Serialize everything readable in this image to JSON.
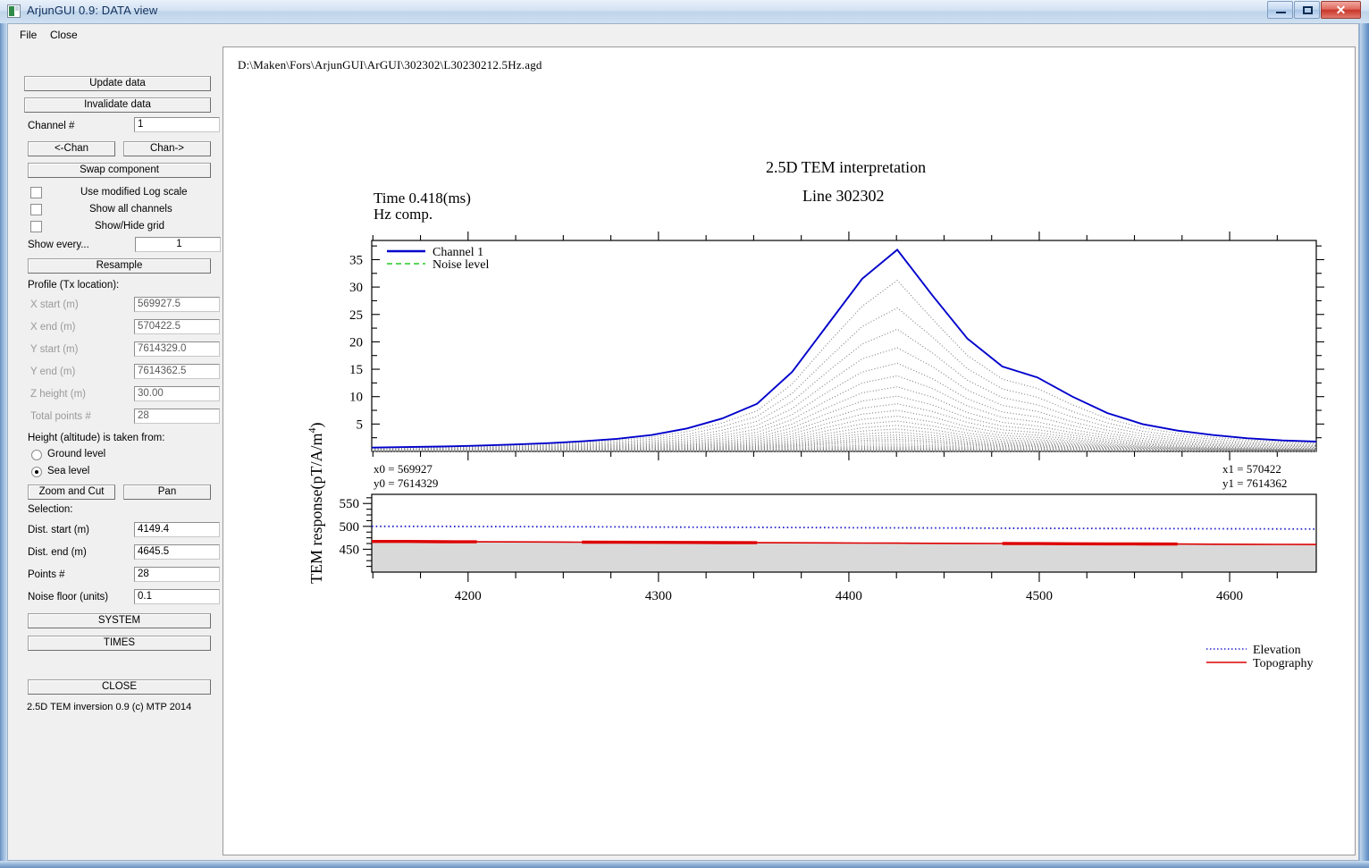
{
  "window": {
    "title": "ArjunGUI 0.9: DATA view",
    "icon": "app-icon",
    "minimize": "minimize-icon",
    "maximize": "maximize-icon",
    "close": "✕"
  },
  "menu": {
    "items": [
      "File",
      "Close"
    ]
  },
  "sidebar": {
    "update_data": "Update data",
    "invalidate_data": "Invalidate data",
    "channel_label": "Channel #",
    "channel_value": "1",
    "chan_prev": "<-Chan",
    "chan_next": "Chan->",
    "swap_component": "Swap component",
    "checkboxes": [
      {
        "label": "Use modified Log scale",
        "checked": false
      },
      {
        "label": "Show all channels",
        "checked": false
      },
      {
        "label": "Show/Hide grid",
        "checked": false
      }
    ],
    "show_every_label": "Show every...",
    "show_every_value": "1",
    "resample": "Resample",
    "profile_header": "Profile (Tx location):",
    "profile_fields": [
      {
        "label": "X start (m)",
        "value": "569927.5"
      },
      {
        "label": "X end (m)",
        "value": "570422.5"
      },
      {
        "label": "Y start (m)",
        "value": "7614329.0"
      },
      {
        "label": "Y end (m)",
        "value": "7614362.5"
      },
      {
        "label": "Z height (m)",
        "value": "30.00"
      },
      {
        "label": "Total points #",
        "value": "28"
      }
    ],
    "height_header": "Height (altitude) is taken from:",
    "height_options": [
      {
        "label": "Ground level",
        "selected": false
      },
      {
        "label": "Sea level",
        "selected": true
      }
    ],
    "zoom_and_cut": "Zoom and Cut",
    "pan": "Pan",
    "selection_header": "Selection:",
    "selection_fields": [
      {
        "label": "Dist. start (m)",
        "value": "4149.4"
      },
      {
        "label": "Dist. end (m)",
        "value": "4645.5"
      },
      {
        "label": "Points #",
        "value": "28"
      },
      {
        "label": "Noise floor (units)",
        "value": "0.1"
      }
    ],
    "system": "SYSTEM",
    "times": "TIMES",
    "close": "CLOSE",
    "copyright": "2.5D TEM inversion 0.9 (c) MTP 2014"
  },
  "plot": {
    "file_path": "D:\\Maken\\Fors\\ArjunGUI\\ArGUI\\302302\\L30230212.5Hz.agd",
    "title": "2.5D TEM interpretation",
    "subtitle": "Line   302302",
    "time_label": "Time   0.418(ms)",
    "component_label": "Hz comp.",
    "coords": {
      "x0_label": "x0 =",
      "x0_value": "569927",
      "y0_label": "y0 =",
      "y0_value": "7614329",
      "x1_label": "x1 =",
      "x1_value": "570422",
      "y1_label": "y1 =",
      "y1_value": "7614362"
    }
  },
  "chart_data": [
    {
      "type": "line",
      "name": "tem-response-plot",
      "title": "2.5D TEM interpretation",
      "subtitle": "Line   302302",
      "xlabel": "",
      "ylabel": "TEM response(pT/A/m",
      "ylabel_sup": "4",
      "ylabel_suffix": ")",
      "xlim": [
        4149.4,
        4645.5
      ],
      "ylim": [
        0,
        38.5
      ],
      "yticks": [
        5,
        10,
        15,
        20,
        25,
        30,
        35
      ],
      "ytick_labels": [
        "5",
        "10",
        "15",
        "20",
        "25",
        "30",
        "35"
      ],
      "xticks": [
        4200,
        4300,
        4400,
        4500,
        4600
      ],
      "grid": false,
      "legend": [
        {
          "label": "Channel 1",
          "color": "#0000cc",
          "style": "solid"
        },
        {
          "label": "Noise level",
          "color": "#22cc22",
          "style": "dashed"
        }
      ],
      "legend_position": "top-left",
      "x": [
        4149.4,
        4167.8,
        4186.2,
        4204.6,
        4223.0,
        4241.4,
        4259.8,
        4278.2,
        4296.6,
        4315.0,
        4333.4,
        4351.8,
        4370.2,
        4388.6,
        4407.0,
        4425.4,
        4443.8,
        4462.2,
        4480.6,
        4499.0,
        4517.4,
        4535.8,
        4554.2,
        4572.6,
        4591.0,
        4609.4,
        4627.8,
        4645.5
      ],
      "series": [
        {
          "name": "Channel 1",
          "color": "#0000cc",
          "style": "solid",
          "values": [
            0.7,
            0.8,
            0.9,
            1.05,
            1.25,
            1.5,
            1.85,
            2.3,
            3.0,
            4.2,
            6.0,
            8.7,
            14.5,
            23.0,
            31.5,
            36.8,
            28.5,
            20.6,
            15.5,
            13.5,
            10.0,
            7.0,
            5.0,
            3.8,
            3.0,
            2.4,
            2.0,
            1.8
          ]
        },
        {
          "name": "Channel 2",
          "color": "#808080",
          "style": "dotted",
          "values": [
            0.6,
            0.68,
            0.78,
            0.9,
            1.05,
            1.3,
            1.6,
            2.0,
            2.6,
            3.6,
            5.2,
            7.4,
            12.3,
            19.6,
            26.5,
            31.2,
            24.2,
            17.5,
            13.2,
            11.5,
            8.5,
            6.0,
            4.3,
            3.3,
            2.6,
            2.1,
            1.75,
            1.55
          ]
        },
        {
          "name": "Channel 3",
          "color": "#808080",
          "style": "dotted",
          "values": [
            0.52,
            0.59,
            0.67,
            0.78,
            0.92,
            1.12,
            1.38,
            1.72,
            2.25,
            3.1,
            4.5,
            6.4,
            10.6,
            16.8,
            22.8,
            26.2,
            20.9,
            15.1,
            11.4,
            9.9,
            7.3,
            5.2,
            3.7,
            2.85,
            2.25,
            1.82,
            1.5,
            1.34
          ]
        },
        {
          "name": "Channel 4",
          "color": "#808080",
          "style": "dotted",
          "values": [
            0.45,
            0.51,
            0.58,
            0.67,
            0.79,
            0.96,
            1.19,
            1.48,
            1.94,
            2.67,
            3.87,
            5.5,
            9.1,
            14.5,
            19.6,
            22.3,
            18.0,
            13.0,
            9.8,
            8.5,
            6.3,
            4.5,
            3.2,
            2.45,
            1.94,
            1.57,
            1.29,
            1.15
          ]
        },
        {
          "name": "Channel 5",
          "color": "#808080",
          "style": "dotted",
          "values": [
            0.39,
            0.44,
            0.5,
            0.58,
            0.68,
            0.83,
            1.02,
            1.28,
            1.67,
            2.3,
            3.33,
            4.74,
            7.8,
            12.5,
            16.9,
            18.9,
            15.5,
            11.2,
            8.4,
            7.3,
            5.4,
            3.87,
            2.75,
            2.11,
            1.67,
            1.35,
            1.11,
            0.99
          ]
        },
        {
          "name": "Channel 6",
          "color": "#808080",
          "style": "dotted",
          "values": [
            0.33,
            0.38,
            0.43,
            0.5,
            0.59,
            0.71,
            0.88,
            1.1,
            1.44,
            1.98,
            2.87,
            4.08,
            6.7,
            10.8,
            14.5,
            16.1,
            13.3,
            9.6,
            7.2,
            6.3,
            4.7,
            3.33,
            2.37,
            1.82,
            1.44,
            1.16,
            0.96,
            0.85
          ]
        },
        {
          "name": "Channel 7",
          "color": "#808080",
          "style": "dotted",
          "values": [
            0.29,
            0.33,
            0.37,
            0.43,
            0.51,
            0.61,
            0.76,
            0.95,
            1.24,
            1.71,
            2.47,
            3.51,
            5.8,
            9.3,
            12.5,
            13.8,
            11.5,
            8.3,
            6.2,
            5.4,
            4.0,
            2.87,
            2.04,
            1.57,
            1.24,
            1.0,
            0.82,
            0.73
          ]
        },
        {
          "name": "Channel 8",
          "color": "#808080",
          "style": "dotted",
          "values": [
            0.25,
            0.28,
            0.32,
            0.37,
            0.44,
            0.53,
            0.65,
            0.82,
            1.07,
            1.47,
            2.13,
            3.02,
            5.0,
            8.0,
            10.7,
            11.8,
            9.9,
            7.1,
            5.3,
            4.65,
            3.45,
            2.47,
            1.76,
            1.35,
            1.07,
            0.86,
            0.71,
            0.63
          ]
        },
        {
          "name": "Channel 9",
          "color": "#808080",
          "style": "dotted",
          "values": [
            0.215,
            0.24,
            0.28,
            0.32,
            0.38,
            0.46,
            0.56,
            0.7,
            0.92,
            1.26,
            1.83,
            2.6,
            4.3,
            6.9,
            9.2,
            10.1,
            8.5,
            6.1,
            4.6,
            4.0,
            2.97,
            2.13,
            1.51,
            1.16,
            0.92,
            0.74,
            0.61,
            0.54
          ]
        },
        {
          "name": "Channel 10",
          "color": "#808080",
          "style": "dotted",
          "values": [
            0.185,
            0.21,
            0.24,
            0.275,
            0.33,
            0.39,
            0.49,
            0.61,
            0.79,
            1.09,
            1.58,
            2.24,
            3.7,
            5.9,
            7.9,
            8.7,
            7.3,
            5.3,
            3.95,
            3.45,
            2.56,
            1.83,
            1.3,
            1.0,
            0.79,
            0.64,
            0.52,
            0.47
          ]
        },
        {
          "name": "Channel 11",
          "color": "#808080",
          "style": "dotted",
          "values": [
            0.16,
            0.18,
            0.205,
            0.24,
            0.28,
            0.34,
            0.42,
            0.52,
            0.68,
            0.94,
            1.36,
            1.93,
            3.19,
            5.1,
            6.8,
            7.5,
            6.3,
            4.5,
            3.4,
            2.97,
            2.2,
            1.58,
            1.12,
            0.86,
            0.68,
            0.55,
            0.45,
            0.4
          ]
        },
        {
          "name": "Channel 12",
          "color": "#808080",
          "style": "dotted",
          "values": [
            0.137,
            0.155,
            0.176,
            0.205,
            0.24,
            0.29,
            0.36,
            0.45,
            0.59,
            0.81,
            1.17,
            1.66,
            2.74,
            4.4,
            5.85,
            6.45,
            5.4,
            3.9,
            2.92,
            2.55,
            1.89,
            1.36,
            0.96,
            0.74,
            0.59,
            0.47,
            0.39,
            0.345
          ]
        },
        {
          "name": "Channel 13",
          "color": "#808080",
          "style": "dotted",
          "values": [
            0.118,
            0.133,
            0.152,
            0.176,
            0.21,
            0.25,
            0.31,
            0.385,
            0.5,
            0.69,
            1.0,
            1.43,
            2.36,
            3.78,
            5.03,
            5.55,
            4.65,
            3.35,
            2.51,
            2.19,
            1.62,
            1.16,
            0.83,
            0.635,
            0.5,
            0.41,
            0.335,
            0.3
          ]
        },
        {
          "name": "Channel 14",
          "color": "#808080",
          "style": "dotted",
          "values": [
            0.1,
            0.114,
            0.13,
            0.151,
            0.178,
            0.215,
            0.265,
            0.33,
            0.43,
            0.595,
            0.86,
            1.22,
            2.02,
            3.25,
            4.32,
            4.77,
            4.0,
            2.88,
            2.16,
            1.88,
            1.39,
            1.0,
            0.71,
            0.545,
            0.43,
            0.35,
            0.29,
            0.255
          ]
        },
        {
          "name": "Channel 15",
          "color": "#808080",
          "style": "dotted",
          "values": [
            0.087,
            0.098,
            0.112,
            0.13,
            0.153,
            0.185,
            0.228,
            0.285,
            0.37,
            0.51,
            0.74,
            1.05,
            1.74,
            2.79,
            3.72,
            4.1,
            3.44,
            2.48,
            1.86,
            1.62,
            1.2,
            0.86,
            0.61,
            0.47,
            0.37,
            0.3,
            0.245,
            0.22
          ]
        },
        {
          "name": "Channel 16",
          "color": "#808080",
          "style": "dotted",
          "values": [
            0.074,
            0.084,
            0.096,
            0.112,
            0.132,
            0.159,
            0.196,
            0.245,
            0.32,
            0.44,
            0.635,
            0.9,
            1.49,
            2.4,
            3.19,
            3.52,
            2.95,
            2.13,
            1.6,
            1.39,
            1.03,
            0.74,
            0.525,
            0.4,
            0.32,
            0.26,
            0.21,
            0.19
          ]
        },
        {
          "name": "Channel 17",
          "color": "#808080",
          "style": "dotted",
          "values": [
            0.064,
            0.072,
            0.083,
            0.096,
            0.113,
            0.137,
            0.169,
            0.21,
            0.275,
            0.38,
            0.545,
            0.775,
            1.28,
            2.06,
            2.74,
            3.02,
            2.54,
            1.83,
            1.37,
            1.2,
            0.885,
            0.635,
            0.45,
            0.345,
            0.275,
            0.22,
            0.18,
            0.16
          ]
        },
        {
          "name": "Channel 18",
          "color": "#808080",
          "style": "dotted",
          "values": [
            0.055,
            0.062,
            0.071,
            0.083,
            0.097,
            0.118,
            0.145,
            0.18,
            0.235,
            0.325,
            0.47,
            0.665,
            1.1,
            1.77,
            2.35,
            2.6,
            2.18,
            1.57,
            1.18,
            1.03,
            0.76,
            0.545,
            0.39,
            0.3,
            0.235,
            0.19,
            0.156,
            0.138
          ]
        },
        {
          "name": "Channel 19",
          "color": "#808080",
          "style": "dotted",
          "values": [
            0.047,
            0.053,
            0.061,
            0.071,
            0.084,
            0.101,
            0.125,
            0.156,
            0.2,
            0.28,
            0.4,
            0.57,
            0.95,
            1.52,
            2.02,
            2.23,
            1.87,
            1.35,
            1.01,
            0.88,
            0.65,
            0.47,
            0.33,
            0.255,
            0.2,
            0.163,
            0.134,
            0.118
          ]
        },
        {
          "name": "Channel 20",
          "color": "#808080",
          "style": "dotted",
          "values": [
            0.041,
            0.046,
            0.052,
            0.061,
            0.072,
            0.087,
            0.107,
            0.134,
            0.175,
            0.24,
            0.35,
            0.49,
            0.81,
            1.31,
            1.74,
            1.92,
            1.61,
            1.16,
            0.87,
            0.76,
            0.56,
            0.4,
            0.285,
            0.22,
            0.175,
            0.14,
            0.115,
            0.102
          ]
        }
      ]
    },
    {
      "type": "line",
      "name": "topography-plot",
      "title": "",
      "ylabel": "",
      "xlabel": "",
      "xlim": [
        4149.4,
        4645.5
      ],
      "ylim": [
        400,
        570
      ],
      "yticks": [
        450,
        500,
        550
      ],
      "ytick_labels": [
        "450",
        "500",
        "550"
      ],
      "xticks": [
        4200,
        4300,
        4400,
        4500,
        4600
      ],
      "xtick_labels": [
        "4200",
        "4300",
        "4400",
        "4500",
        "4600"
      ],
      "grid": false,
      "legend": [
        {
          "label": "Elevation",
          "color": "#2222cc",
          "style": "dotted"
        },
        {
          "label": "Topography",
          "color": "#dd0000",
          "style": "solid"
        }
      ],
      "legend_position": "bottom-right",
      "x": [
        4149.4,
        4167.8,
        4186.2,
        4204.6,
        4223.0,
        4241.4,
        4259.8,
        4278.2,
        4296.6,
        4315.0,
        4333.4,
        4351.8,
        4370.2,
        4388.6,
        4407.0,
        4425.4,
        4443.8,
        4462.2,
        4480.6,
        4499.0,
        4517.4,
        4535.8,
        4554.2,
        4572.6,
        4591.0,
        4609.4,
        4627.8,
        4645.5
      ],
      "series": [
        {
          "name": "Elevation",
          "color": "#2222cc",
          "style": "dotted",
          "values": [
            500,
            500,
            499.8,
            499.6,
            499.4,
            499.2,
            499.0,
            498.8,
            498.5,
            498.3,
            498.0,
            497.8,
            497.5,
            497.3,
            497.0,
            496.8,
            496.5,
            496.3,
            496.0,
            495.8,
            495.6,
            495.4,
            495.2,
            495.0,
            494.8,
            494.6,
            494.4,
            494.2
          ]
        },
        {
          "name": "Topography",
          "color": "#dd0000",
          "style": "solid",
          "values": [
            467,
            467,
            466.5,
            466.2,
            466,
            465.8,
            465.5,
            465.2,
            465,
            464.8,
            464.5,
            464.3,
            464,
            463.8,
            463.5,
            463.3,
            463,
            462.8,
            462.5,
            462.3,
            462,
            461.8,
            461.5,
            461.3,
            461,
            460.8,
            460.5,
            460.3
          ]
        }
      ],
      "fill_color": "#d9d9d9"
    }
  ]
}
